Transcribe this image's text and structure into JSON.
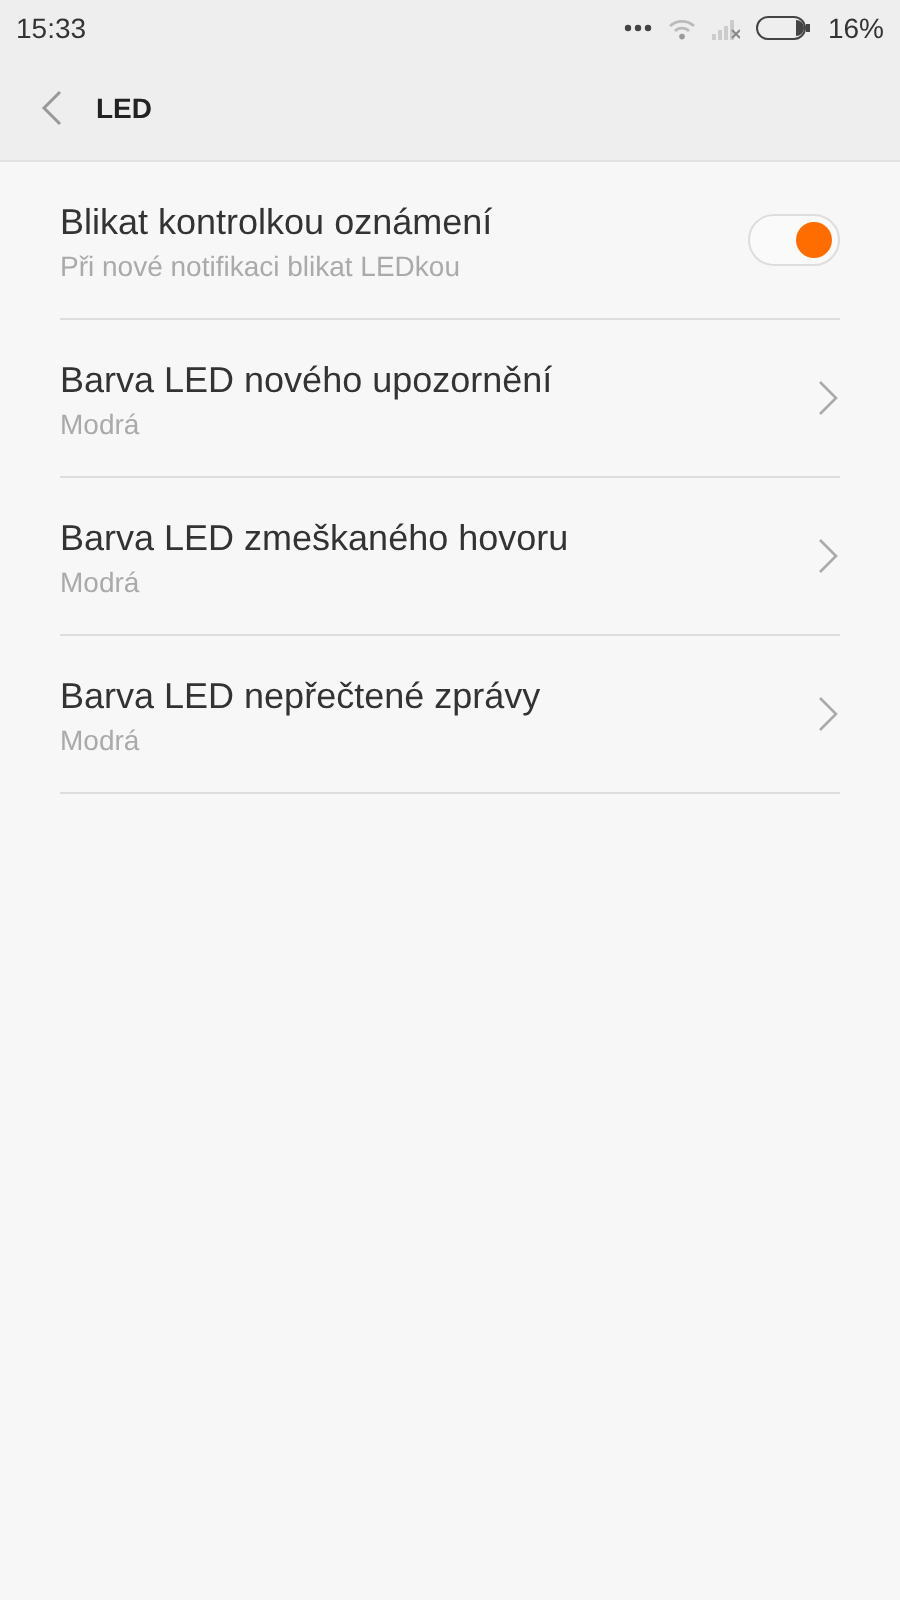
{
  "status_bar": {
    "time": "15:33",
    "battery": "16%"
  },
  "header": {
    "title": "LED"
  },
  "items": [
    {
      "kind": "toggle",
      "title": "Blikat kontrolkou oznámení",
      "subtitle": "Při nové notifikaci blikat LEDkou",
      "on": true
    },
    {
      "kind": "link",
      "title": "Barva LED nového upozornění",
      "subtitle": "Modrá"
    },
    {
      "kind": "link",
      "title": "Barva LED zmeškaného hovoru",
      "subtitle": "Modrá"
    },
    {
      "kind": "link",
      "title": "Barva LED nepřečtené zprávy",
      "subtitle": "Modrá"
    }
  ]
}
